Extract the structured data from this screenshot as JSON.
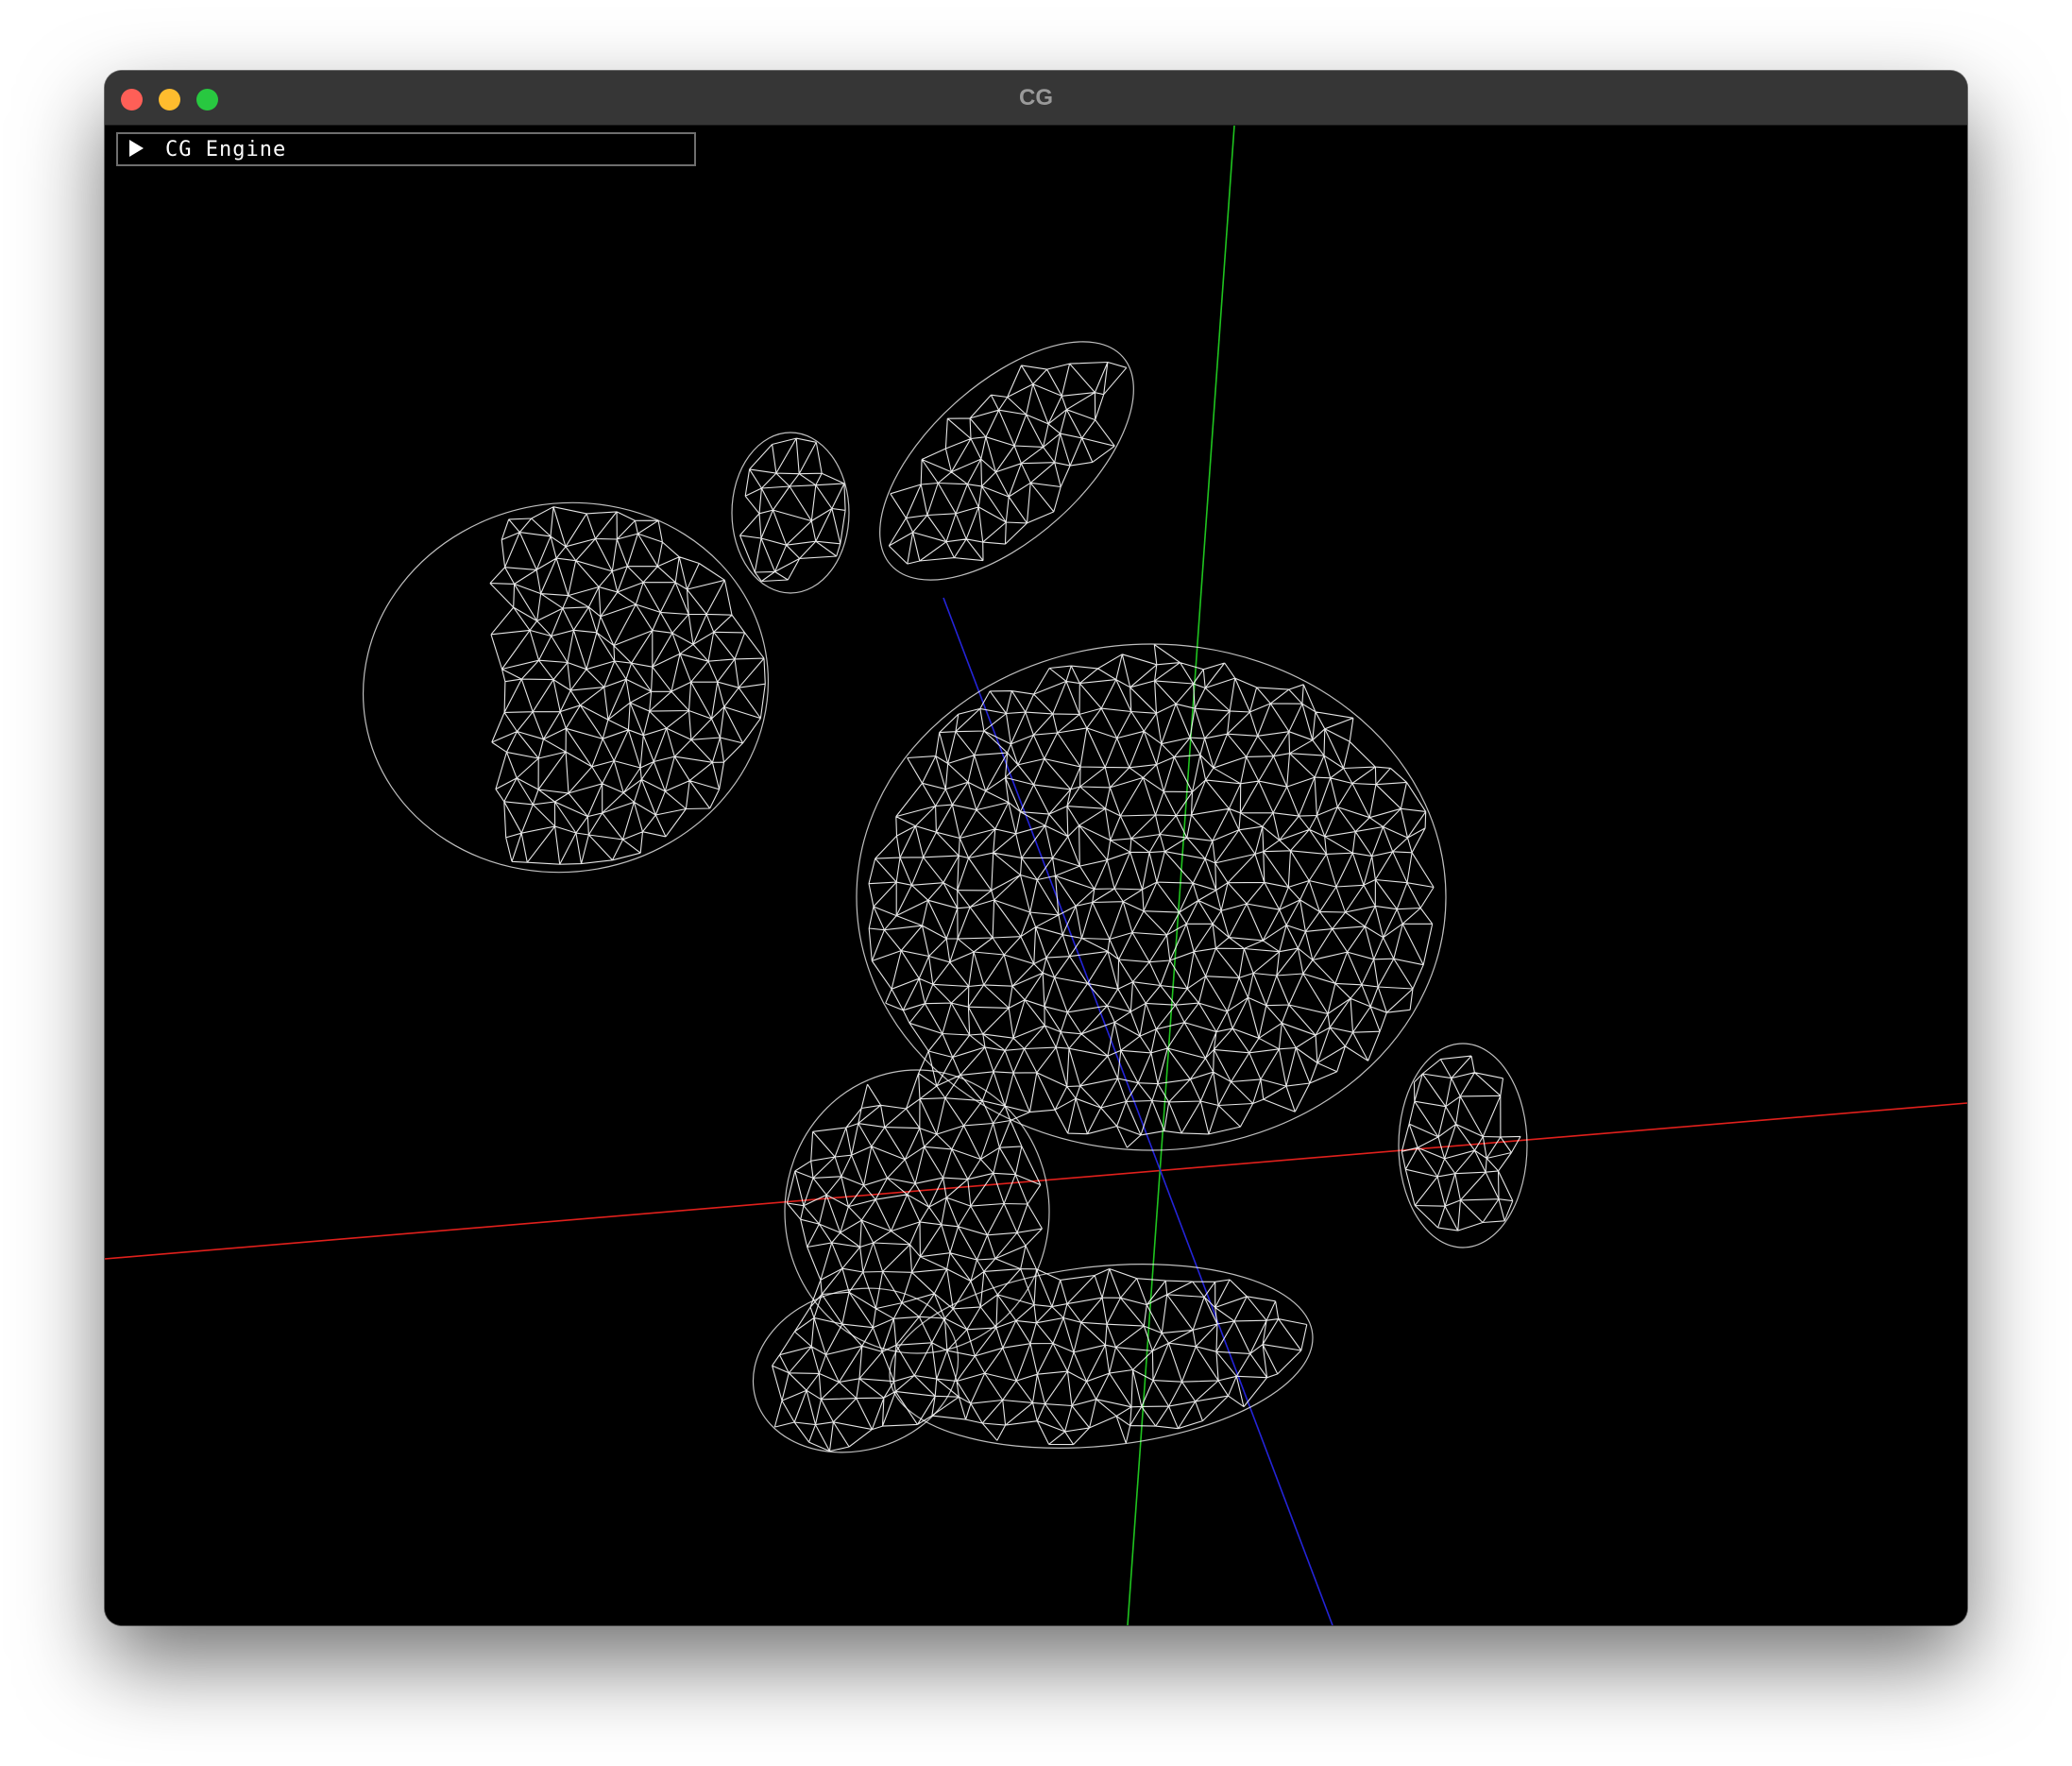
{
  "window": {
    "title": "CG",
    "controls": [
      "close",
      "minimize",
      "maximize"
    ]
  },
  "viewport": {
    "background": "#000000",
    "mesh_color": "#ffffff",
    "axis_colors": {
      "x": "#e0201c",
      "y": "#1fc41f",
      "z": "#2424d8"
    }
  },
  "panel": {
    "title": "CG Engine",
    "collapsed": true,
    "icon": "triangle-right-icon"
  }
}
